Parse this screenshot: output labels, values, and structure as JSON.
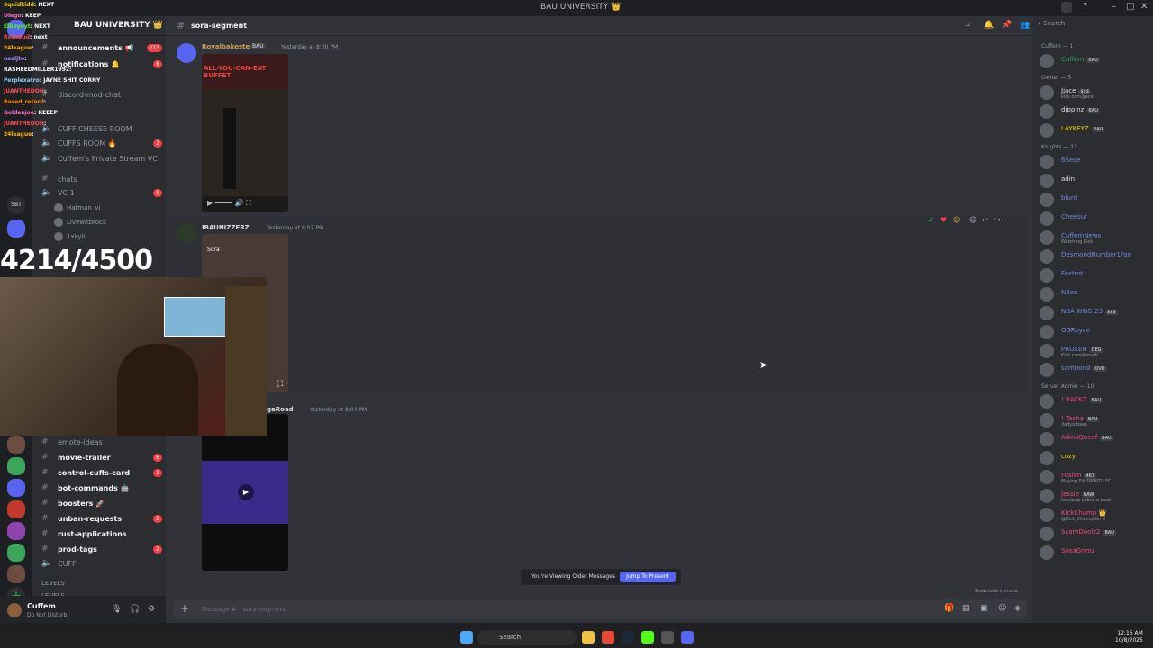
{
  "window": {
    "title": "BAU UNIVERSITY 👑"
  },
  "sidebar": {
    "server_name": "BAU UNIVERSITY 👑",
    "channels_top": [
      {
        "label": "announcements 📢",
        "count": "213"
      },
      {
        "label": "notifications 🔔",
        "count": "6"
      },
      {
        "label": "discord-mod-chat",
        "count": ""
      },
      {
        "label": "CUFF CHEESE ROOM",
        "count": ""
      },
      {
        "label": "CUFFS ROOM 🔥",
        "count": "2"
      },
      {
        "label": "Cuffem's Private Stream VC",
        "count": ""
      },
      {
        "label": "chats",
        "count": ""
      },
      {
        "label": "VC 1",
        "count": "9"
      }
    ],
    "voice_users": [
      "Hatman_vi",
      "Livewitbrock",
      "1xkyli"
    ],
    "channels_bottom": [
      {
        "label": "emote-ideas",
        "count": ""
      },
      {
        "label": "movie-trailer",
        "count": "6"
      },
      {
        "label": "control-cuffs-card",
        "count": "1"
      },
      {
        "label": "bot-commands 🤖",
        "count": ""
      },
      {
        "label": "boosters 🚀",
        "count": ""
      },
      {
        "label": "unban-requests",
        "count": "2"
      },
      {
        "label": "rust-applications",
        "count": ""
      },
      {
        "label": "prod-tags",
        "count": "2"
      },
      {
        "label": "CUFF",
        "count": ""
      }
    ],
    "categories": [
      "LEVELS",
      "levels"
    ],
    "user": {
      "name": "Cuffem",
      "status": "Do Not Disturb"
    }
  },
  "header": {
    "channel": "sora-segment",
    "search_placeholder": "Search"
  },
  "messages": [
    {
      "author": "Royalbakester",
      "tag": "BAU",
      "time": "Yesterday at 8:00 PM",
      "color": "#cfa15a",
      "media_caption": "ALL-YOU-CAN-EAT BUFFET"
    },
    {
      "author": "IBAUNIZZERZ",
      "tag": "",
      "time": "Yesterday at 8:02 PM",
      "color": "#dbdee1",
      "media_caption": "Sora"
    },
    {
      "author": "geRoad",
      "tag": "",
      "time": "Yesterday at 8:04 PM",
      "color": "#dbdee1",
      "media_caption": ""
    }
  ],
  "older_bar": {
    "text": "You're Viewing Older Messages",
    "button": "Jump To Present"
  },
  "composer": {
    "placeholder": "Message # · sora-segment"
  },
  "slowmode": "Slowmode Immune",
  "members": {
    "groups": [
      {
        "label": "Cuffem — 1",
        "items": [
          {
            "name": "Cuffem",
            "tag": "BAU",
            "color": "#3ba55c",
            "sub": ""
          }
        ]
      },
      {
        "label": "Owner — 5",
        "items": [
          {
            "name": "Jjace",
            "tag": "$$$",
            "color": "#dbdee1",
            "sub": "kick.com/jjace"
          },
          {
            "name": "dippinz",
            "tag": "BAU",
            "color": "#dbdee1",
            "sub": ""
          },
          {
            "name": "LAYKEYZ",
            "tag": "BAU",
            "color": "#f0d000",
            "sub": ""
          }
        ]
      },
      {
        "label": "Knights — 12",
        "items": [
          {
            "name": "6Sece",
            "tag": "",
            "color": "#7289da",
            "sub": ""
          },
          {
            "name": "adin",
            "tag": "",
            "color": "#dbdee1",
            "sub": ""
          },
          {
            "name": "blurri",
            "tag": "",
            "color": "#7289da",
            "sub": ""
          },
          {
            "name": "Cheesur",
            "tag": "",
            "color": "#7289da",
            "sub": ""
          },
          {
            "name": "CuffemNews",
            "tag": "",
            "color": "#7289da",
            "sub": "Watching Kick"
          },
          {
            "name": "DesmondNumber1Fan",
            "tag": "",
            "color": "#7289da",
            "sub": ""
          },
          {
            "name": "Foxtrot",
            "tag": "",
            "color": "#7289da",
            "sub": ""
          },
          {
            "name": "N3on",
            "tag": "",
            "color": "#7289da",
            "sub": ""
          },
          {
            "name": "NBA-KING-23",
            "tag": "$$$",
            "color": "#7289da",
            "sub": ""
          },
          {
            "name": "OGRoyce",
            "tag": "",
            "color": "#7289da",
            "sub": ""
          },
          {
            "name": "PROXEH",
            "tag": "DEG",
            "color": "#7289da",
            "sub": "Kick.com/Proxeh"
          },
          {
            "name": "sambond",
            "tag": "OVO",
            "color": "#7289da",
            "sub": ""
          }
        ]
      },
      {
        "label": "Server Admin — 10",
        "items": [
          {
            "name": "! RACKZ",
            "tag": "BAU",
            "color": "#f04a7a",
            "sub": ""
          },
          {
            "name": "! Tasha",
            "tag": "BAU",
            "color": "#f04a7a",
            "sub": "/ladyofbaes"
          },
          {
            "name": "AdinsQueef",
            "tag": "BAU",
            "color": "#f04a7a",
            "sub": ""
          },
          {
            "name": "cozy",
            "tag": "",
            "color": "#f0d000",
            "sub": ""
          },
          {
            "name": "Fusion",
            "tag": "467",
            "color": "#f04a7a",
            "sub": "Playing EA SPORTS FC ..."
          },
          {
            "name": "Jessie",
            "tag": "RAW",
            "color": "#f04a7a",
            "sub": "no sleep cobra is back"
          },
          {
            "name": "KickChamp 👑",
            "tag": "",
            "color": "#f04a7a",
            "sub": "@Kick_Champ On X"
          },
          {
            "name": "ScamDoolz2",
            "tag": "BAU",
            "color": "#f04a7a",
            "sub": ""
          },
          {
            "name": "SosaGrimz",
            "tag": "",
            "color": "#f04a7a",
            "sub": ""
          }
        ]
      }
    ]
  },
  "overlay": {
    "counter": "4214/4500",
    "chat": [
      {
        "user": "Squidkidd",
        "text": "NEXT"
      },
      {
        "user": "Diego",
        "text": "KEEP"
      },
      {
        "user": "Elbbyoyt",
        "text": "NEXT"
      },
      {
        "user": "RothBud",
        "text": "next"
      },
      {
        "user": "24league",
        "text": ""
      },
      {
        "user": "nosijto",
        "text": ""
      },
      {
        "user": "RASHEEDMILLER1992",
        "text": ""
      },
      {
        "user": "Perplexatro",
        "text": "JAYNE SHIT CORNY"
      },
      {
        "user": "JUANTHEDON",
        "text": ""
      },
      {
        "user": "Based_retard",
        "text": ""
      },
      {
        "user": "Goldenjoe",
        "text": "KEEEP"
      },
      {
        "user": "JUANTHEDON",
        "text": ""
      },
      {
        "user": "24league",
        "text": ""
      }
    ]
  },
  "taskbar": {
    "search": "Search",
    "time": "12:16 AM",
    "date": "10/8/2025"
  },
  "server_rail_label": "SBT"
}
